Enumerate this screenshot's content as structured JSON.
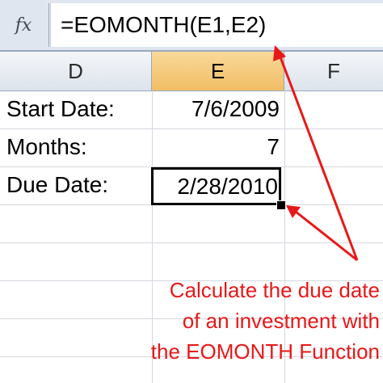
{
  "formula_bar": {
    "fx_label": "fx",
    "formula": "=EOMONTH(E1,E2)"
  },
  "columns": [
    "D",
    "E",
    "F"
  ],
  "selected_column": "E",
  "rows": [
    {
      "label": "Start Date:",
      "value": "7/6/2009"
    },
    {
      "label": "Months:",
      "value": "7"
    },
    {
      "label": "Due Date:",
      "value": "2/28/2010"
    }
  ],
  "annotation": {
    "lines": [
      "Calculate the due date",
      "of an investment with",
      "the EOMONTH Function"
    ]
  },
  "colors": {
    "annotation": "#e81818",
    "selected_header": "#f1bd63",
    "formula_bar_bg": "#dfe6f0"
  }
}
